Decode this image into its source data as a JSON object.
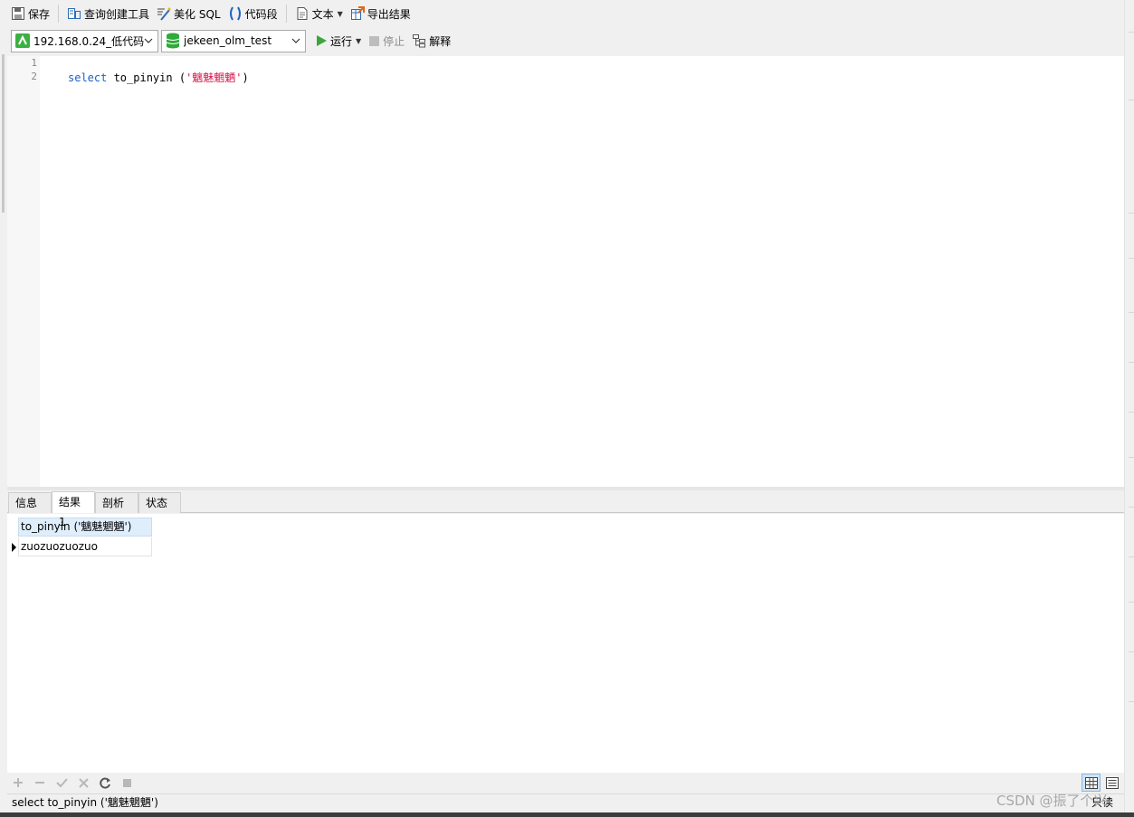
{
  "toolbar": {
    "save": "保存",
    "query_builder": "查询创建工具",
    "beautify_sql": "美化 SQL",
    "code_snippet": "代码段",
    "text": "文本",
    "export_result": "导出结果"
  },
  "connection": {
    "server": "192.168.0.24_低代码",
    "database": "jekeen_olm_test",
    "run": "运行",
    "stop": "停止",
    "explain": "解释"
  },
  "editor": {
    "line_numbers": [
      "1",
      "2"
    ],
    "keyword": "select",
    "function_text": " to_pinyin (",
    "string_literal": "'魑魅魍魉'",
    "closing": ")"
  },
  "result_tabs": [
    "信息",
    "结果 1",
    "剖析",
    "状态"
  ],
  "active_tab": "结果 1",
  "grid": {
    "column_header": "to_pinyin ('魑魅魍魉')",
    "rows": [
      [
        "zuozuozuozuo"
      ]
    ]
  },
  "status": {
    "sql": "select to_pinyin ('魑魅魍魉')",
    "mode": "只读"
  },
  "watermark": "CSDN @振了个兴",
  "colors": {
    "keyword": "#1a63c6",
    "string": "#d8174c",
    "run_icon": "#3aa63a",
    "header_bg": "#dfeefb"
  }
}
